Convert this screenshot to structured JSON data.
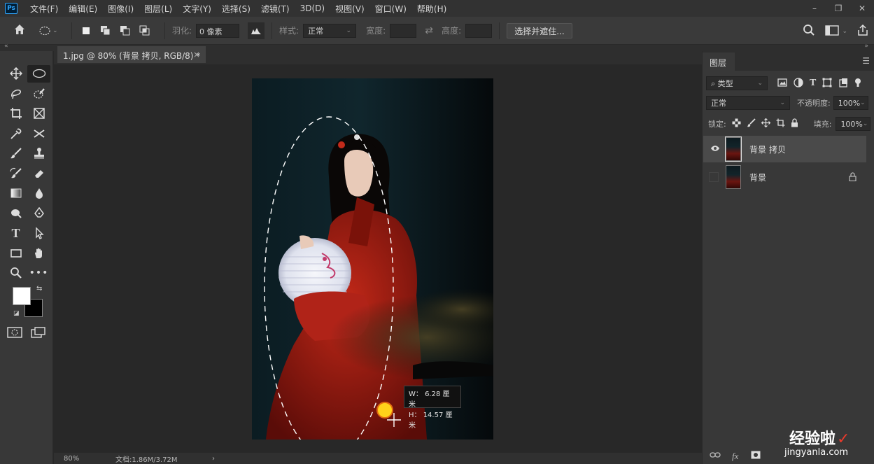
{
  "app": {
    "logo": "Ps"
  },
  "menu": [
    "文件(F)",
    "编辑(E)",
    "图像(I)",
    "图层(L)",
    "文字(Y)",
    "选择(S)",
    "滤镜(T)",
    "3D(D)",
    "视图(V)",
    "窗口(W)",
    "帮助(H)"
  ],
  "window_controls": {
    "minimize": "–",
    "restore": "❐",
    "close": "✕"
  },
  "options": {
    "feather_label": "羽化:",
    "feather_value": "0 像素",
    "style_label": "样式:",
    "style_value": "正常",
    "width_label": "宽度:",
    "height_label": "高度:",
    "select_mask_button": "选择并遮住..."
  },
  "document": {
    "tab_title": "1.jpg @ 80% (背景 拷贝, RGB/8) *",
    "close": "×",
    "zoom": "80%",
    "doc_info": "文档:1.86M/3.72M",
    "arrow": "›"
  },
  "selection_readout": {
    "w": "W： 6.28 厘米",
    "h": "H： 14.57 厘米"
  },
  "layers_panel": {
    "tab": "图层",
    "filter_kind": "类型",
    "blend_mode": "正常",
    "opacity_label": "不透明度:",
    "opacity_value": "100%",
    "lock_label": "锁定:",
    "fill_label": "填充:",
    "fill_value": "100%",
    "layers": [
      {
        "name": "背景 拷贝",
        "visible": true,
        "selected": true,
        "locked": false
      },
      {
        "name": "背景",
        "visible": false,
        "selected": false,
        "locked": true
      }
    ]
  },
  "watermark": {
    "text": "经验啦",
    "check": "✓",
    "url": "jingyanla.com"
  },
  "colors": {
    "accent": "#31a8ff",
    "foreground": "#ffffff",
    "background": "#000000",
    "cursor": "#ffd21a"
  }
}
